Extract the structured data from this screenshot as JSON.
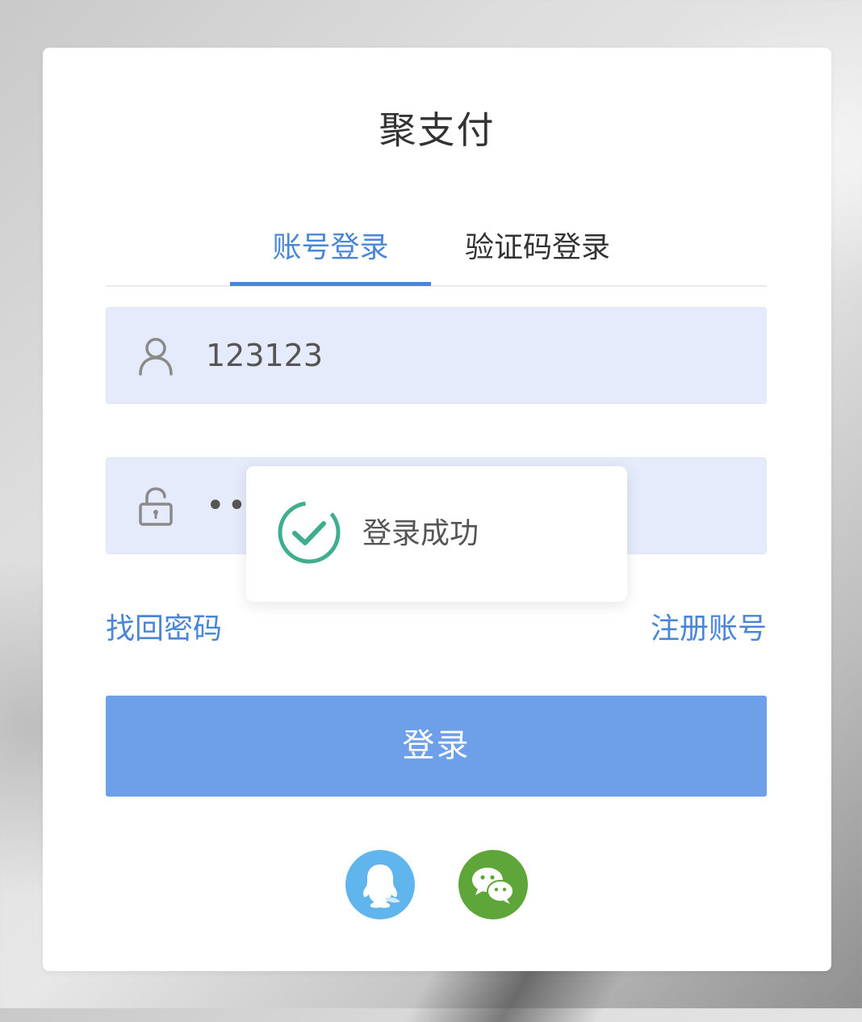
{
  "app": {
    "title": "聚支付"
  },
  "tabs": [
    {
      "label": "账号登录",
      "active": true
    },
    {
      "label": "验证码登录",
      "active": false
    }
  ],
  "form": {
    "username": {
      "icon": "user-icon",
      "value": "123123"
    },
    "password": {
      "icon": "lock-icon",
      "value": "•••"
    }
  },
  "links": {
    "forgot_password": "找回密码",
    "register": "注册账号"
  },
  "login_button": {
    "label": "登录"
  },
  "social_login": [
    {
      "icon": "qq-icon"
    },
    {
      "icon": "wechat-icon"
    }
  ],
  "toast": {
    "icon": "check-circle-icon",
    "message": "登录成功"
  },
  "colors": {
    "accent": "#4a86d8",
    "button": "#6ea0e9",
    "input_bg": "#e5ebfa",
    "qq": "#5fb5ec",
    "wechat": "#5fa63a",
    "success": "#3fae8f"
  }
}
